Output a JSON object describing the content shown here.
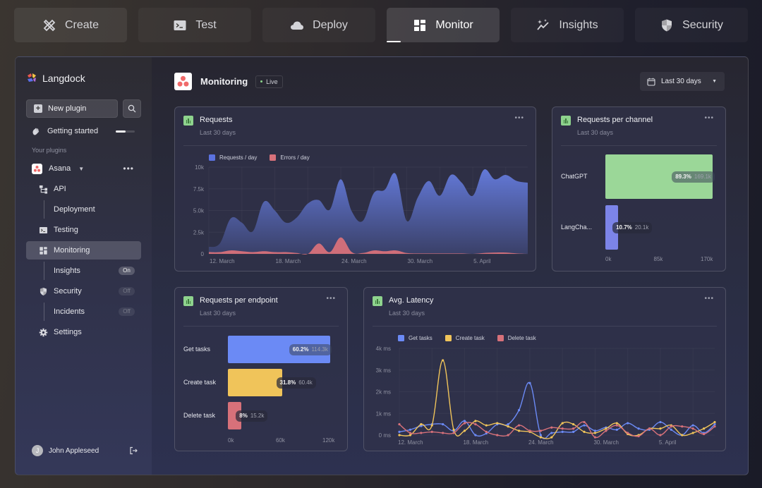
{
  "top_tabs": [
    {
      "label": "Create",
      "icon": "tools-icon",
      "active": false
    },
    {
      "label": "Test",
      "icon": "terminal-icon",
      "active": false
    },
    {
      "label": "Deploy",
      "icon": "cloud-icon",
      "active": false
    },
    {
      "label": "Monitor",
      "icon": "dashboard-icon",
      "active": true
    },
    {
      "label": "Insights",
      "icon": "sparkle-chart-icon",
      "active": false
    },
    {
      "label": "Security",
      "icon": "shield-icon",
      "active": false
    }
  ],
  "sidebar": {
    "brand": "Langdock",
    "new_plugin_label": "New plugin",
    "getting_started": {
      "label": "Getting started",
      "progress": 0.5
    },
    "section_label": "Your plugins",
    "plugin": {
      "name": "Asana"
    },
    "items": [
      {
        "label": "API",
        "level": "l1",
        "icon": "api-tree-icon"
      },
      {
        "label": "Deployment",
        "level": "sub"
      },
      {
        "label": "Testing",
        "level": "l1",
        "icon": "terminal-icon"
      },
      {
        "label": "Monitoring",
        "level": "l1",
        "icon": "dashboard-icon",
        "active": true
      },
      {
        "label": "Insights",
        "level": "sub",
        "toggle": "On"
      },
      {
        "label": "Security",
        "level": "l1",
        "icon": "shield-icon",
        "toggle": "Off"
      },
      {
        "label": "Incidents",
        "level": "sub",
        "toggle": "Off"
      },
      {
        "label": "Settings",
        "level": "l1",
        "icon": "gear-icon"
      }
    ],
    "user": {
      "name": "John Appleseed",
      "initial": "J"
    }
  },
  "header": {
    "title": "Monitoring",
    "status": "Live",
    "date_range": "Last 30 days"
  },
  "cards": {
    "requests": {
      "title": "Requests",
      "subtitle": "Last 30 days"
    },
    "per_channel": {
      "title": "Requests per channel",
      "subtitle": "Last 30 days"
    },
    "per_endpoint": {
      "title": "Requests per endpoint",
      "subtitle": "Last 30 days"
    },
    "latency": {
      "title": "Avg. Latency",
      "subtitle": "Last 30 days"
    }
  },
  "chart_data": [
    {
      "id": "requests",
      "type": "area",
      "title": "Requests",
      "subtitle": "Last 30 days",
      "legend": "top-left",
      "grid": true,
      "ylim": [
        0,
        10000
      ],
      "yticks": [
        "0",
        "2.5k",
        "5.0k",
        "7.5k",
        "10k"
      ],
      "xticks": [
        {
          "label": "12. March",
          "index": 0
        },
        {
          "label": "18. March",
          "index": 6
        },
        {
          "label": "24. March",
          "index": 12
        },
        {
          "label": "30. March",
          "index": 18
        },
        {
          "label": "5. April",
          "index": 24
        }
      ],
      "series": [
        {
          "name": "Requests / day",
          "color": "#5b72e0",
          "values": [
            800,
            1200,
            4100,
            3600,
            2600,
            6000,
            5000,
            3600,
            4200,
            5800,
            6200,
            5100,
            8600,
            4900,
            3800,
            7000,
            7400,
            9200,
            3800,
            6500,
            8400,
            6700,
            9100,
            8200,
            6700,
            9700,
            8600,
            9100,
            8400,
            8200
          ]
        },
        {
          "name": "Errors / day",
          "color": "#d7717a",
          "values": [
            200,
            200,
            400,
            300,
            200,
            300,
            200,
            200,
            100,
            0,
            1200,
            200,
            1900,
            200,
            100,
            400,
            300,
            400,
            100,
            50,
            50,
            50,
            50,
            50,
            0,
            100,
            150,
            150,
            50,
            0
          ]
        }
      ]
    },
    {
      "id": "per_channel",
      "type": "bar",
      "orientation": "horizontal",
      "title": "Requests per channel",
      "categories": [
        "ChatGPT",
        "LangCha..."
      ],
      "values": [
        169100,
        20100
      ],
      "value_labels": [
        "169.1k",
        "20.1k"
      ],
      "percent_labels": [
        "89.3%",
        "10.7%"
      ],
      "colors": [
        "#9bd798",
        "#7c84e8"
      ],
      "xlim": [
        0,
        170000
      ],
      "xticks": [
        "0k",
        "85k",
        "170k"
      ]
    },
    {
      "id": "per_endpoint",
      "type": "bar",
      "orientation": "horizontal",
      "title": "Requests per endpoint",
      "categories": [
        "Get tasks",
        "Create task",
        "Delete task"
      ],
      "values": [
        114300,
        60400,
        15200
      ],
      "value_labels": [
        "114.3k",
        "60.4k",
        "15.2k"
      ],
      "percent_labels": [
        "60.2%",
        "31.8%",
        "8%"
      ],
      "colors": [
        "#6b8af5",
        "#f0c45a",
        "#d7717a"
      ],
      "xlim": [
        0,
        120000
      ],
      "xticks": [
        "0k",
        "60k",
        "120k"
      ]
    },
    {
      "id": "latency",
      "type": "line",
      "title": "Avg. Latency",
      "subtitle": "Last 30 days",
      "legend": "top-left",
      "grid": true,
      "ylim": [
        0,
        4000
      ],
      "yticks": [
        "0 ms",
        "1k ms",
        "2k ms",
        "3k ms",
        "4k ms"
      ],
      "xticks": [
        {
          "label": "12. March",
          "index": 0
        },
        {
          "label": "18. March",
          "index": 6
        },
        {
          "label": "24. March",
          "index": 12
        },
        {
          "label": "30. March",
          "index": 18
        },
        {
          "label": "5. April",
          "index": 24
        }
      ],
      "series": [
        {
          "name": "Get tasks",
          "color": "#6b8af5",
          "values": [
            150,
            250,
            420,
            500,
            500,
            200,
            650,
            0,
            80,
            500,
            500,
            1150,
            2400,
            0,
            100,
            150,
            150,
            450,
            200,
            350,
            250,
            550,
            300,
            250,
            600,
            250,
            0,
            450,
            100,
            500
          ]
        },
        {
          "name": "Create task",
          "color": "#f0c45a",
          "values": [
            0,
            0,
            500,
            450,
            3450,
            250,
            200,
            650,
            450,
            550,
            400,
            200,
            150,
            -100,
            -100,
            550,
            500,
            150,
            100,
            300,
            550,
            50,
            0,
            300,
            300,
            450,
            0,
            100,
            300,
            600
          ]
        },
        {
          "name": "Delete task",
          "color": "#d7717a",
          "values": [
            500,
            100,
            100,
            150,
            100,
            100,
            550,
            500,
            150,
            0,
            0,
            450,
            200,
            200,
            350,
            300,
            300,
            600,
            -100,
            200,
            450,
            100,
            -50,
            300,
            0,
            400,
            400,
            300,
            50,
            400
          ]
        }
      ]
    }
  ]
}
